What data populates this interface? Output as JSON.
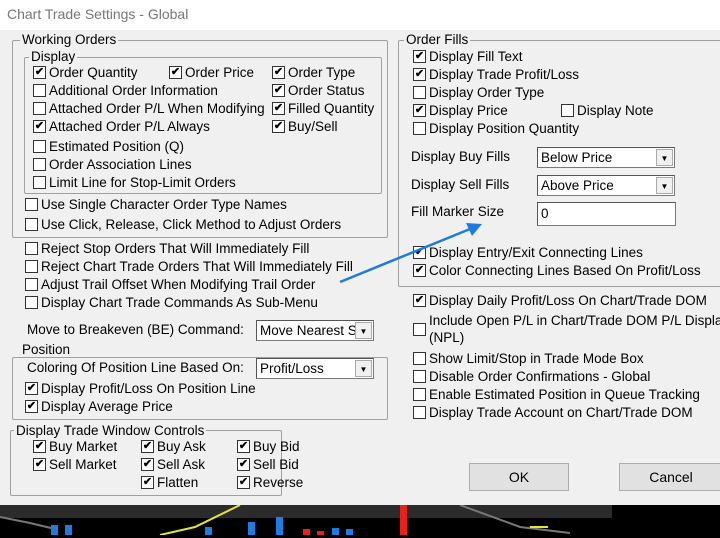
{
  "window": {
    "title": "Chart Trade Settings - Global"
  },
  "working_orders": {
    "label": "Working Orders",
    "display": {
      "label": "Display",
      "items": [
        {
          "label": "Order Quantity",
          "checked": true
        },
        {
          "label": "Order Price",
          "checked": true
        },
        {
          "label": "Order Type",
          "checked": true
        },
        {
          "label": "Additional Order Information",
          "checked": false
        },
        {
          "label": "Order Status",
          "checked": true
        },
        {
          "label": "Attached Order P/L When Modifying",
          "checked": false
        },
        {
          "label": "Filled Quantity",
          "checked": true
        },
        {
          "label": "Attached Order P/L Always",
          "checked": true
        },
        {
          "label": "Buy/Sell",
          "checked": true
        },
        {
          "label": "Estimated Position (Q)",
          "checked": false
        },
        {
          "label": "Order Association Lines",
          "checked": false
        },
        {
          "label": "Limit Line for Stop-Limit Orders",
          "checked": false
        }
      ]
    },
    "options": [
      {
        "label": "Use Single Character Order Type Names",
        "checked": false
      },
      {
        "label": "Use Click, Release, Click Method to Adjust Orders",
        "checked": false
      }
    ]
  },
  "general": [
    {
      "label": "Reject Stop Orders That Will Immediately Fill",
      "checked": false
    },
    {
      "label": "Reject Chart Trade Orders That Will Immediately Fill",
      "checked": false
    },
    {
      "label": "Adjust Trail Offset When Modifying Trail Order",
      "checked": false
    },
    {
      "label": "Display Chart Trade Commands As Sub-Menu",
      "checked": false
    }
  ],
  "breakeven": {
    "label": "Move to Breakeven (BE) Command:",
    "value": "Move Nearest St"
  },
  "position": {
    "label": "Position",
    "coloring_label": "Coloring Of Position Line Based On:",
    "coloring_value": "Profit/Loss",
    "items": [
      {
        "label": "Display Profit/Loss On Position Line",
        "checked": true
      },
      {
        "label": "Display Average Price",
        "checked": true
      }
    ]
  },
  "trade_window": {
    "label": "Display Trade Window Controls",
    "items": [
      {
        "label": "Buy Market",
        "checked": true
      },
      {
        "label": "Buy Ask",
        "checked": true
      },
      {
        "label": "Buy Bid",
        "checked": true
      },
      {
        "label": "Sell Market",
        "checked": true
      },
      {
        "label": "Sell Ask",
        "checked": true
      },
      {
        "label": "Sell Bid",
        "checked": true
      },
      {
        "label": "Flatten",
        "checked": true
      },
      {
        "label": "Reverse",
        "checked": true
      }
    ]
  },
  "order_fills": {
    "label": "Order Fills",
    "items": [
      {
        "label": "Display Fill Text",
        "checked": true
      },
      {
        "label": "Display Trade Profit/Loss",
        "checked": true
      },
      {
        "label": "Display Order Type",
        "checked": false
      },
      {
        "label": "Display Price",
        "checked": true
      },
      {
        "label": "Display Note",
        "checked": false
      },
      {
        "label": "Display Position Quantity",
        "checked": false
      }
    ],
    "buy_fills_label": "Display Buy Fills",
    "buy_fills_value": "Below Price",
    "sell_fills_label": "Display Sell Fills",
    "sell_fills_value": "Above Price",
    "marker_size_label": "Fill Marker Size",
    "marker_size_value": "0",
    "lines": [
      {
        "label": "Display Entry/Exit Connecting Lines",
        "checked": true
      },
      {
        "label": "Color Connecting Lines Based On Profit/Loss",
        "checked": true
      }
    ]
  },
  "misc": [
    {
      "label": "Display Daily Profit/Loss On Chart/Trade DOM",
      "checked": true
    },
    {
      "label": "Include Open P/L in Chart/Trade DOM P/L Display",
      "label2": "(NPL)",
      "checked": false
    },
    {
      "label": "Show Limit/Stop in Trade Mode Box",
      "checked": false
    },
    {
      "label": "Disable Order Confirmations - Global",
      "checked": false
    },
    {
      "label": "Enable Estimated Position in Queue Tracking",
      "checked": false
    },
    {
      "label": "Display Trade Account on Chart/Trade DOM",
      "checked": false
    }
  ],
  "buttons": {
    "ok": "OK",
    "cancel": "Cancel"
  },
  "colors": {
    "annotation_arrow": "#1e7be0",
    "dialog_bg": "#f0f0f0"
  }
}
